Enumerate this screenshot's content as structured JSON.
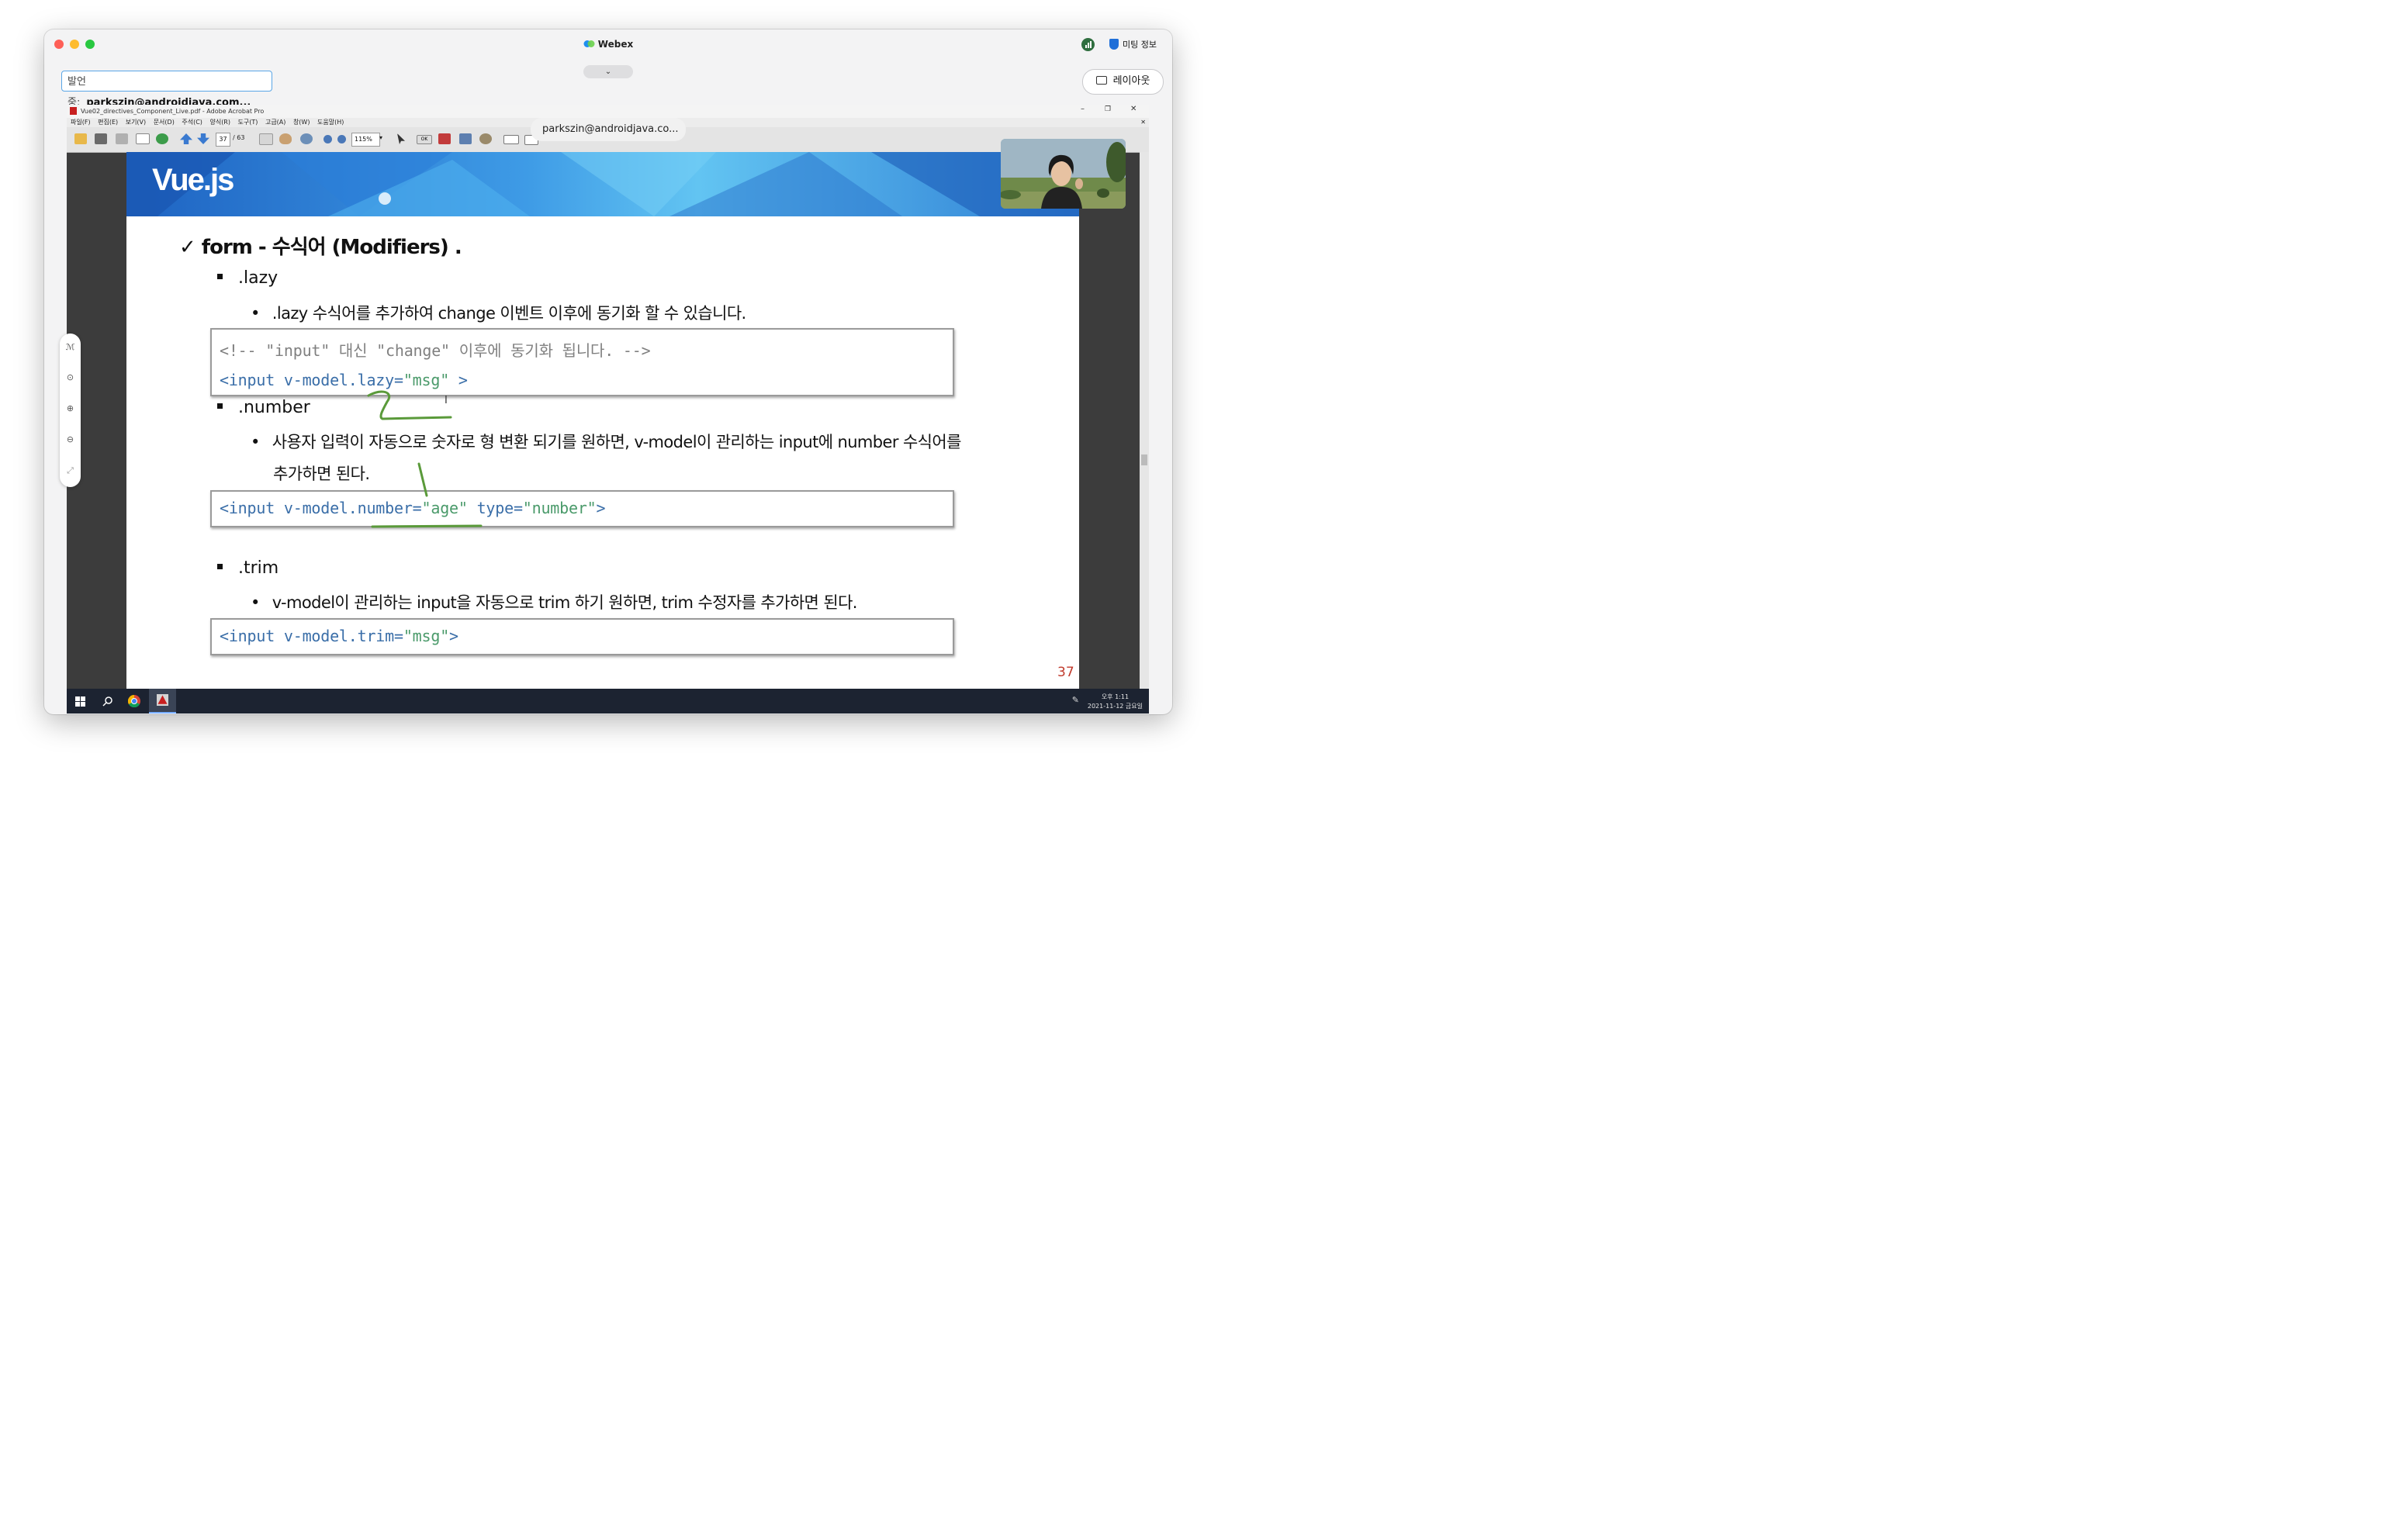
{
  "webex": {
    "title": "Webex",
    "meeting_info": "미팅 정보",
    "presenter_label": "발언 중:",
    "presenter_name": "parkszin@androidjava.com...",
    "layout_label": "레이아웃",
    "collapse_icon": "chevron-down-icon",
    "share_pill": "parkszin@androidjava.co..."
  },
  "acrobat": {
    "title": "Vue02_directives_Component_Live.pdf - Adobe Acrobat Pro",
    "menus": [
      "파일(F)",
      "편집(E)",
      "보기(V)",
      "문서(D)",
      "주석(C)",
      "양식(R)",
      "도구(T)",
      "고급(A)",
      "창(W)",
      "도움말(H)"
    ],
    "page_current": "37",
    "page_total": "/ 63",
    "zoom": "115%"
  },
  "slide": {
    "logo": "Vue.js",
    "check": "✓",
    "heading": "form - 수식어 (Modifiers) .",
    "lazy_title": ".lazy",
    "lazy_desc": ".lazy 수식어를 추가하여 change 이벤트 이후에 동기화 할 수 있습니다.",
    "lazy_code": {
      "comment": "<!-- \"input\" 대신 \"change\" 이후에 동기화 됩니다. -->",
      "tag": "<input v-model.lazy=",
      "value": "\"msg\"",
      "close": " >"
    },
    "number_title": ".number",
    "number_desc_line1": "사용자 입력이 자동으로 숫자로 형 변환 되기를 원하면, v-model이 관리하는 input에 number 수식어를",
    "number_desc_line2": "추가하면 된다.",
    "number_code": {
      "tag": "<input v-model.number=",
      "value": "\"age\"",
      "attr": " type=",
      "value2": "\"number\"",
      "close": ">"
    },
    "trim_title": ".trim",
    "trim_desc": "v-model이 관리하는 input을 자동으로 trim 하기 원하면, trim 수정자를 추가하면 된다.",
    "trim_code": {
      "tag": "<input v-model.trim=",
      "value": "\"msg\"",
      "close": ">"
    },
    "page_number": "37"
  },
  "taskbar": {
    "time": "오후 1:11",
    "date": "2021-11-12 금요일"
  },
  "colors": {
    "annotation": "#5a9a3a",
    "presenter_border": "#5aa6e6",
    "page_number": "#c0392b"
  }
}
